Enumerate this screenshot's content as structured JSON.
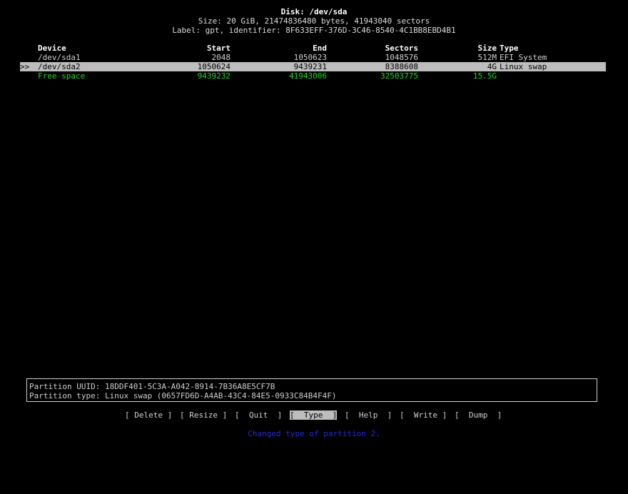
{
  "header": {
    "title": "Disk: /dev/sda",
    "size": "Size: 20 GiB, 21474836480 bytes, 41943040 sectors",
    "label": "Label: gpt, identifier: 8F633EFF-376D-3C46-8540-4C1BB8EBD4B1"
  },
  "table": {
    "columns": [
      "Device",
      "Start",
      "End",
      "Sectors",
      "Size",
      "Type"
    ],
    "rows": [
      {
        "marker": "",
        "device": "/dev/sda1",
        "start": "2048",
        "end": "1050623",
        "sectors": "1048576",
        "size": "512M",
        "type": "EFI System"
      },
      {
        "marker": ">>",
        "device": "/dev/sda2",
        "start": "1050624",
        "end": "9439231",
        "sectors": "8388608",
        "size": "4G",
        "type": "Linux swap"
      },
      {
        "marker": "",
        "device": "Free space",
        "start": "9439232",
        "end": "41943006",
        "sectors": "32503775",
        "size": "15.5G",
        "type": ""
      }
    ]
  },
  "details": {
    "uuid": "Partition UUID: 18DDF401-5C3A-A042-8914-7B36A8E5CF7B",
    "type": "Partition type: Linux swap (0657FD6D-A4AB-43C4-84E5-0933C84B4F4F)"
  },
  "menu": {
    "items": [
      "[ Delete ]",
      "[ Resize ]",
      "[  Quit  ]",
      "[  Type  ]",
      "[  Help  ]",
      "[  Write ]",
      "[  Dump  ]"
    ]
  },
  "status": "Changed type of partition 2.",
  "colors": {
    "background": "#000000",
    "text": "#cfcfcf",
    "header_text": "#ffffff",
    "selected_bg": "#bdbdbd",
    "free_space": "#29d129",
    "status": "#2a2ad8"
  }
}
